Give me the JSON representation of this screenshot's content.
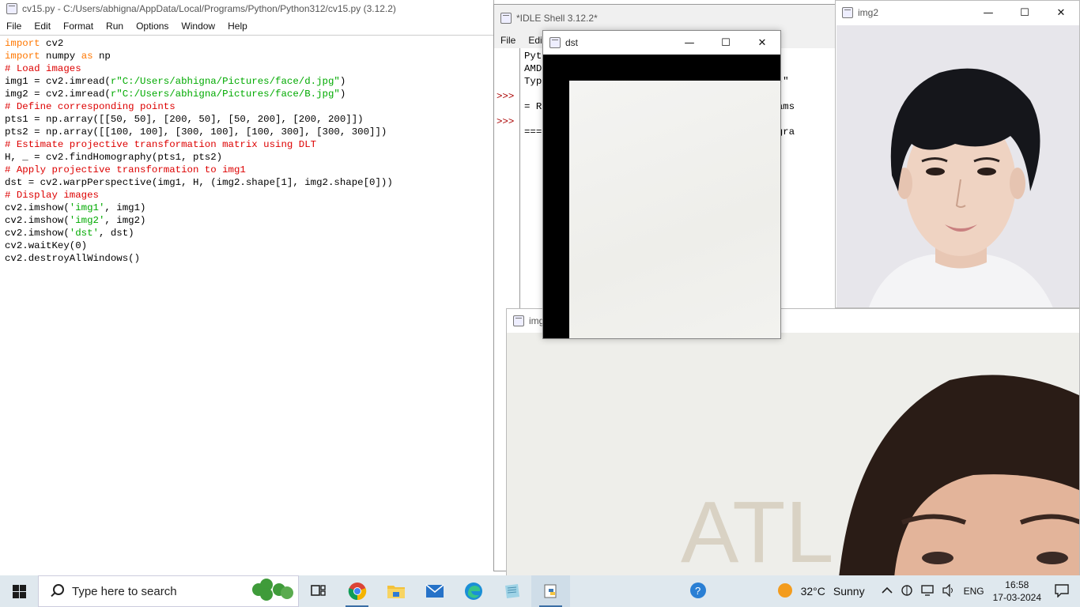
{
  "editor": {
    "title": "cv15.py - C:/Users/abhigna/AppData/Local/Programs/Python/Python312/cv15.py (3.12.2)",
    "menu": [
      "File",
      "Edit",
      "Format",
      "Run",
      "Options",
      "Window",
      "Help"
    ],
    "lines": [
      [
        {
          "t": "import",
          "c": "kw"
        },
        {
          "t": " cv2",
          "c": ""
        }
      ],
      [
        {
          "t": "import",
          "c": "kw"
        },
        {
          "t": " numpy ",
          "c": ""
        },
        {
          "t": "as",
          "c": "kw"
        },
        {
          "t": " np",
          "c": ""
        }
      ],
      [
        {
          "t": "# Load images",
          "c": "cm"
        }
      ],
      [
        {
          "t": "img1 = cv2.imread(",
          "c": ""
        },
        {
          "t": "r\"C:/Users/abhigna/Pictures/face/d.jpg\"",
          "c": "st"
        },
        {
          "t": ")",
          "c": ""
        }
      ],
      [
        {
          "t": "img2 = cv2.imread(",
          "c": ""
        },
        {
          "t": "r\"C:/Users/abhigna/Pictures/face/B.jpg\"",
          "c": "st"
        },
        {
          "t": ")",
          "c": ""
        }
      ],
      [
        {
          "t": "# Define corresponding points",
          "c": "cm"
        }
      ],
      [
        {
          "t": "pts1 = np.array([[50, 50], [200, 50], [50, 200], [200, 200]])",
          "c": ""
        }
      ],
      [
        {
          "t": "pts2 = np.array([[100, 100], [300, 100], [100, 300], [300, 300]])",
          "c": ""
        }
      ],
      [
        {
          "t": "# Estimate projective transformation matrix using DLT",
          "c": "cm"
        }
      ],
      [
        {
          "t": "H, _ = cv2.findHomography(pts1, pts2)",
          "c": ""
        }
      ],
      [
        {
          "t": "# Apply projective transformation to img1",
          "c": "cm"
        }
      ],
      [
        {
          "t": "dst = cv2.warpPerspective(img1, H, (img2.shape[1], img2.shape[0]))",
          "c": ""
        }
      ],
      [
        {
          "t": "# Display images",
          "c": "cm"
        }
      ],
      [
        {
          "t": "cv2.imshow(",
          "c": ""
        },
        {
          "t": "'img1'",
          "c": "st"
        },
        {
          "t": ", img1)",
          "c": ""
        }
      ],
      [
        {
          "t": "cv2.imshow(",
          "c": ""
        },
        {
          "t": "'img2'",
          "c": "st"
        },
        {
          "t": ", img2)",
          "c": ""
        }
      ],
      [
        {
          "t": "cv2.imshow(",
          "c": ""
        },
        {
          "t": "'dst'",
          "c": "st"
        },
        {
          "t": ", dst)",
          "c": ""
        }
      ],
      [
        {
          "t": "cv2.waitKey(0)",
          "c": ""
        }
      ],
      [
        {
          "t": "cv2.destroyAllWindows()",
          "c": ""
        }
      ]
    ]
  },
  "shell": {
    "title": "*IDLE Shell 3.12.2*",
    "menu": [
      "File",
      "Edit"
    ],
    "prompts": [
      ">>>",
      ">>>"
    ],
    "lines": [
      "Pyt                                  6 2024,",
      "AMD",
      "Typ                                 icense()\"",
      "",
      "= R                                 l/Programs",
      "",
      "===                                 cal/Progra"
    ]
  },
  "img2_window": {
    "title": "img2"
  },
  "img1_window": {
    "title": "img1",
    "sign_text": "ATL"
  },
  "dst_window": {
    "title": "dst"
  },
  "caption": {
    "minimize": "—",
    "maximize": "☐",
    "close": "✕"
  },
  "taskbar": {
    "search_placeholder": "Type here to search",
    "weather_temp": "32°C",
    "weather_text": "Sunny",
    "language": "ENG",
    "time": "16:58",
    "date": "17-03-2024",
    "apps": [
      "task-view",
      "chrome",
      "file-explorer",
      "mail",
      "edge",
      "notepad",
      "python-idle"
    ]
  },
  "colors": {
    "keyword": "#ff7700",
    "comment": "#dd0000",
    "string": "#00aa00",
    "taskbar": "#dfe8ee"
  }
}
